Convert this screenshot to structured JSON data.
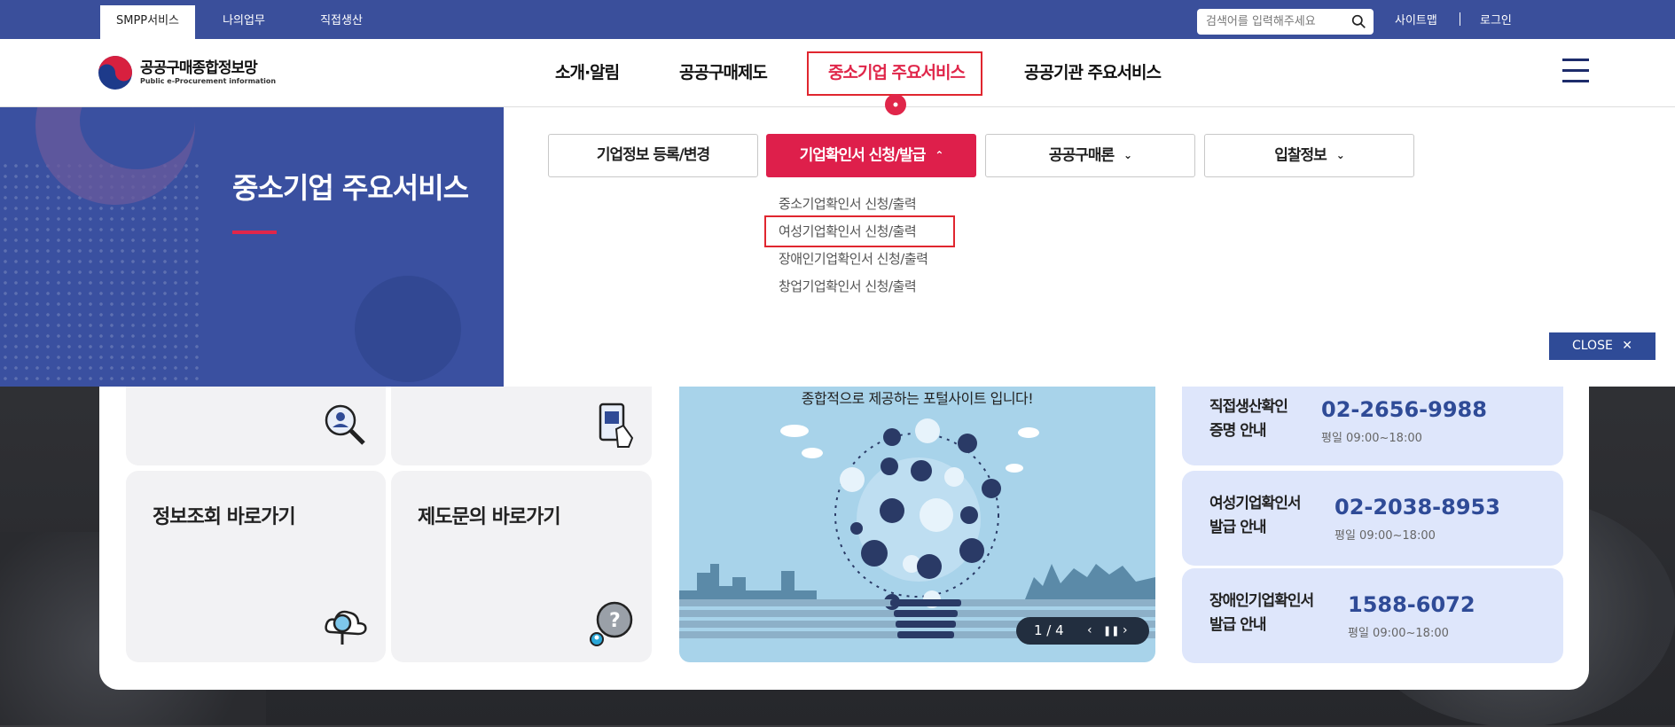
{
  "topbar": {
    "tabs": [
      "SMPP서비스",
      "나의업무",
      "직접생산"
    ],
    "search_placeholder": "검색어를 입력해주세요",
    "sitemap": "사이트맵",
    "login": "로그인"
  },
  "logo": {
    "kr": "공공구매종합정보망",
    "en": "Public e-Procurement information"
  },
  "gnb": [
    "소개·알림",
    "공공구매제도",
    "중소기업 주요서비스",
    "공공기관 주요서비스"
  ],
  "mega": {
    "title": "중소기업 주요서비스",
    "tabs": [
      "기업정보 등록/변경",
      "기업확인서 신청/발급",
      "공공구매론",
      "입찰정보"
    ],
    "sub_items": [
      "중소기업확인서 신청/출력",
      "여성기업확인서 신청/출력",
      "장애인기업확인서 신청/출력",
      "창업기업확인서 신청/출력"
    ],
    "close": "CLOSE"
  },
  "cards": [
    {
      "title": "정보조회 바로가기"
    },
    {
      "title": "제도문의 바로가기"
    }
  ],
  "banner": {
    "text": "종합적으로 제공하는 포털사이트 입니다!",
    "pager": "1 / 4"
  },
  "contacts": [
    {
      "label1": "직접생산확인",
      "label2": "증명 안내",
      "phone": "02-2656-9988",
      "hours": "평일 09:00~18:00"
    },
    {
      "label1": "여성기업확인서",
      "label2": "발급 안내",
      "phone": "02-2038-8953",
      "hours": "평일 09:00~18:00"
    },
    {
      "label1": "장애인기업확인서",
      "label2": "발급 안내",
      "phone": "1588-6072",
      "hours": "평일 09:00~18:00"
    }
  ],
  "colors": {
    "brand_blue": "#3a50a0",
    "accent_red": "#de1f4b",
    "phone_blue": "#2f4b97"
  }
}
